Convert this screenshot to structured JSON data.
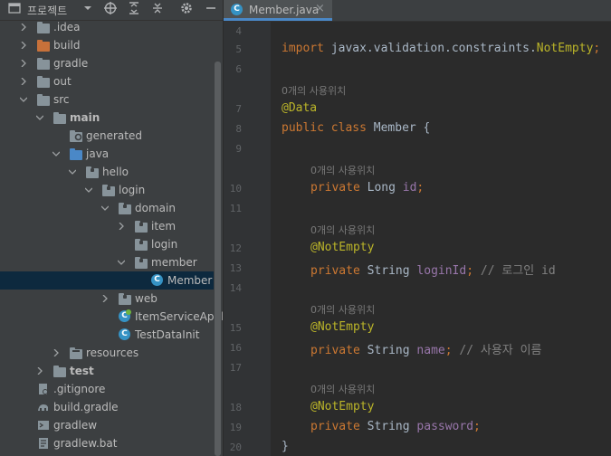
{
  "project_panel": {
    "title": "프로젝트",
    "tree": [
      {
        "label": ".idea",
        "icon": "folder-gray"
      },
      {
        "label": "build",
        "icon": "folder-orange"
      },
      {
        "label": "gradle",
        "icon": "folder-gray"
      },
      {
        "label": "out",
        "icon": "folder-gray"
      },
      {
        "label": "src",
        "icon": "folder-gray"
      },
      {
        "label": "main",
        "icon": "folder-gray"
      },
      {
        "label": "generated",
        "icon": "folder-generated"
      },
      {
        "label": "java",
        "icon": "folder-blue"
      },
      {
        "label": "hello",
        "icon": "package"
      },
      {
        "label": "login",
        "icon": "package"
      },
      {
        "label": "domain",
        "icon": "package"
      },
      {
        "label": "item",
        "icon": "package"
      },
      {
        "label": "login",
        "icon": "package"
      },
      {
        "label": "member",
        "icon": "package"
      },
      {
        "label": "Member",
        "icon": "class"
      },
      {
        "label": "web",
        "icon": "package"
      },
      {
        "label": "ItemServiceApplic",
        "icon": "spring-class"
      },
      {
        "label": "TestDataInit",
        "icon": "class"
      },
      {
        "label": "resources",
        "icon": "folder-gray"
      },
      {
        "label": "test",
        "icon": "folder-gray"
      },
      {
        "label": ".gitignore",
        "icon": "file-gitignore"
      },
      {
        "label": "build.gradle",
        "icon": "file-gradle"
      },
      {
        "label": "gradlew",
        "icon": "file-shell"
      },
      {
        "label": "gradlew.bat",
        "icon": "file-bat"
      }
    ]
  },
  "editor": {
    "tab_label": "Member.java",
    "line_numbers": [
      "4",
      "5",
      "6",
      "7",
      "8",
      "9",
      "10",
      "11",
      "12",
      "13",
      "14",
      "15",
      "16",
      "17",
      "18",
      "19",
      "20"
    ],
    "usage_hint": "0개의 사용위치",
    "code": {
      "l5_import": "import",
      "l5_pkg": "javax.validation.constraints.",
      "l5_cls": "NotEmpty",
      "l7_ann": "@Data",
      "l8_kw1": "public",
      "l8_kw2": "class",
      "l8_name": "Member {",
      "l10_kw": "private",
      "l10_type": "Long",
      "l10_field": "id",
      "ann_notempty": "@NotEmpty",
      "l13_kw": "private",
      "l13_type": "String",
      "l13_field": "loginId",
      "l13_comment": "// 로그인 id",
      "l16_kw": "private",
      "l16_type": "String",
      "l16_field": "name",
      "l16_comment": "// 사용자 이름",
      "l19_kw": "private",
      "l19_type": "String",
      "l19_field": "password",
      "l20_close": "}",
      "semicolon": ";"
    }
  },
  "colors": {
    "background": "#2b2b2b",
    "keyword": "#cc7832",
    "annotation": "#bbb529",
    "field": "#9876aa",
    "comment": "#808080",
    "selection": "#0d293e"
  }
}
